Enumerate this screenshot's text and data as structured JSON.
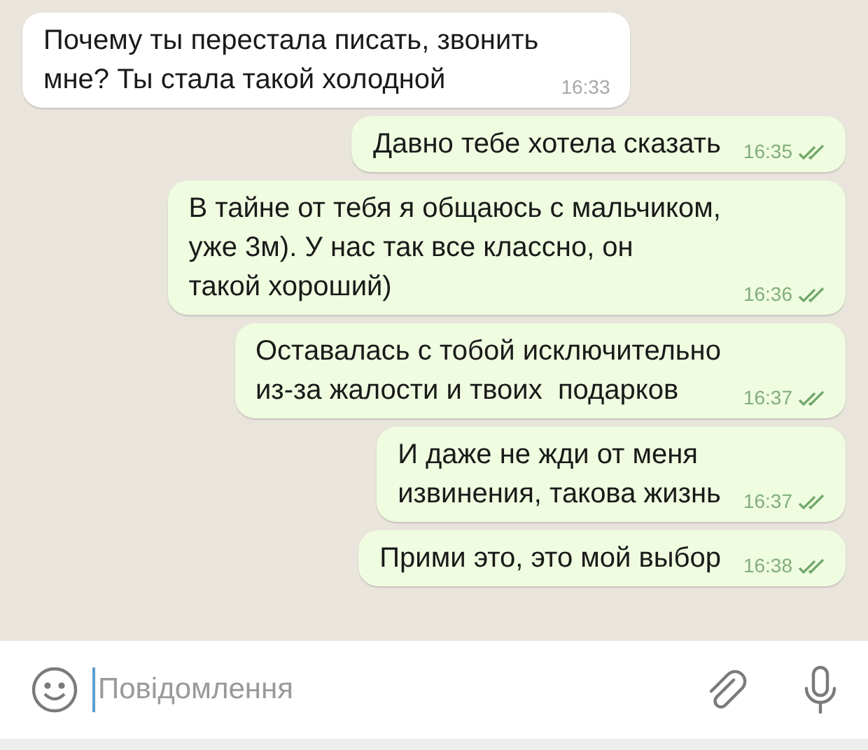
{
  "messages": [
    {
      "kind": "incoming",
      "text": "Почему ты перестала писать, звонить\nмне? Ты стала такой холодной",
      "time": "16:33",
      "delivered": false
    },
    {
      "kind": "outgoing",
      "text": "Давно тебе хотела сказать",
      "time": "16:35",
      "delivered": true
    },
    {
      "kind": "outgoing",
      "text": "В тайне от тебя я общаюсь с мальчиком,\nуже 3м). У нас так все классно, он\nтакой хороший)",
      "time": "16:36",
      "delivered": true
    },
    {
      "kind": "outgoing",
      "text": "Оставалась с тобой исключительно\nиз-за жалости и твоих  подарков",
      "time": "16:37",
      "delivered": true
    },
    {
      "kind": "outgoing",
      "text": "И даже не жди от меня\nизвинения, такова жизнь",
      "time": "16:37",
      "delivered": true
    },
    {
      "kind": "outgoing",
      "text": "Прими это, это мой выбор",
      "time": "16:38",
      "delivered": true
    }
  ],
  "composer": {
    "placeholder": "Повідомлення"
  }
}
